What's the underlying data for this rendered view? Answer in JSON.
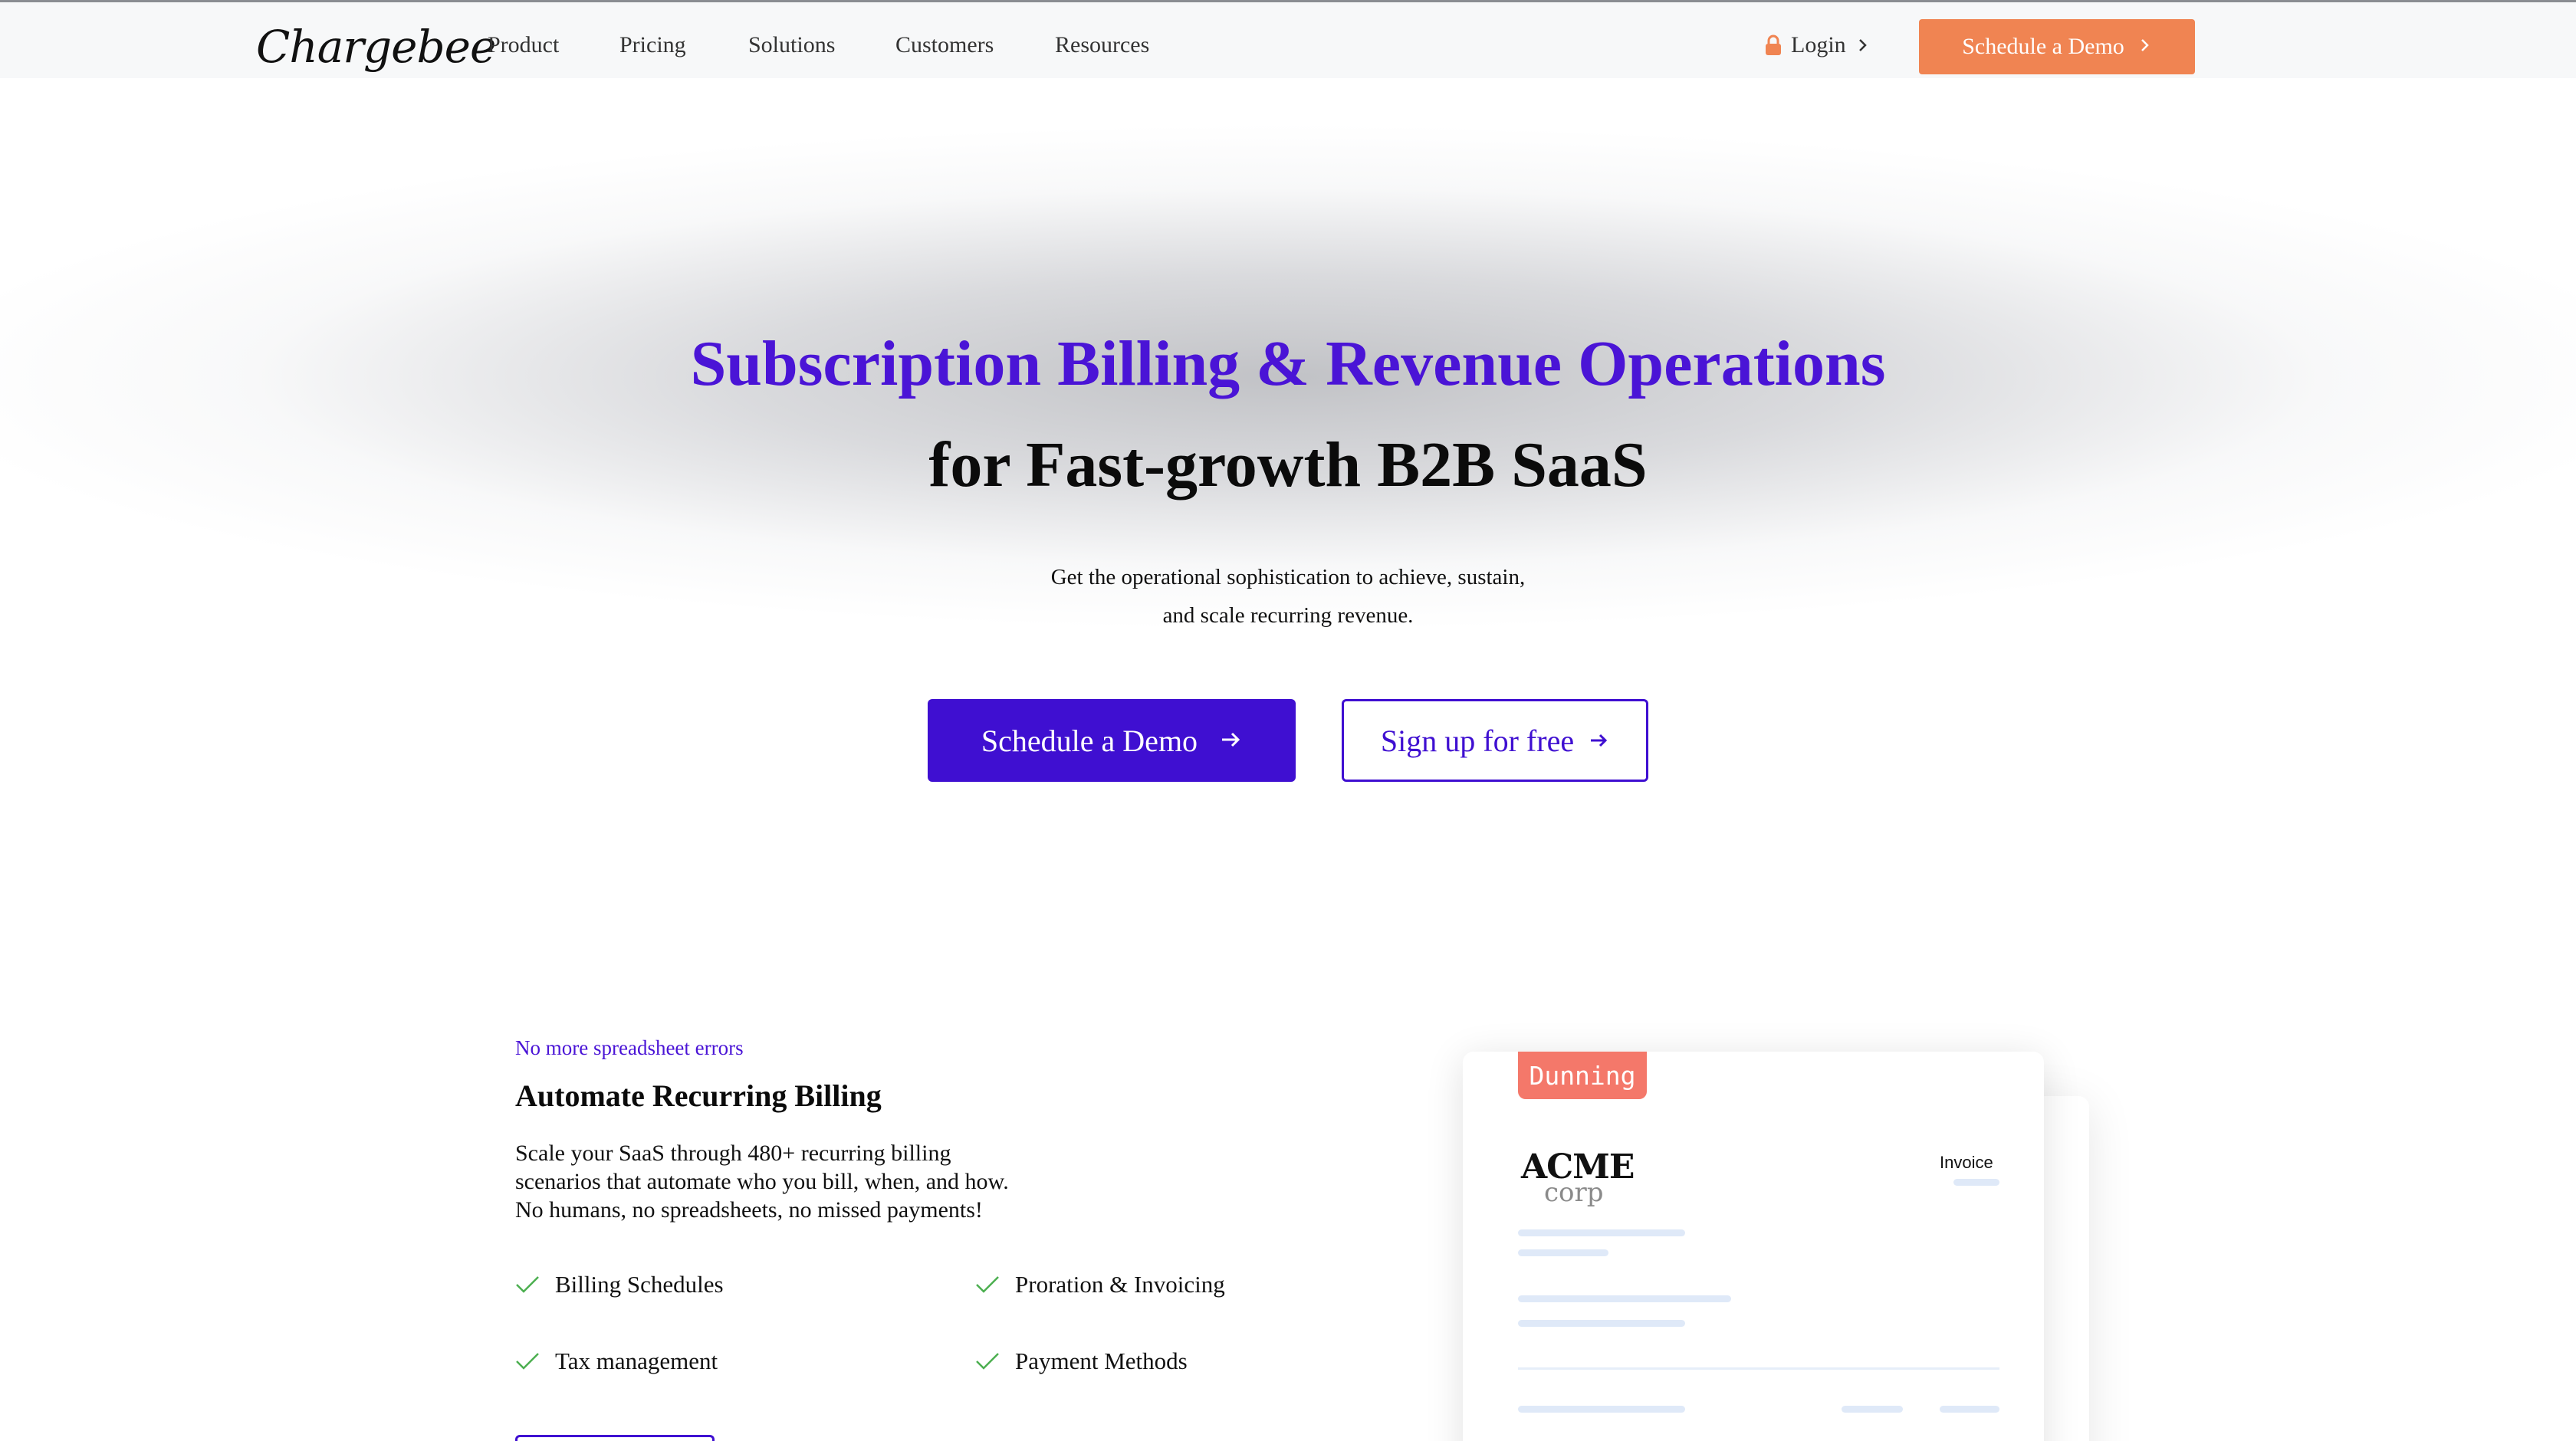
{
  "nav": {
    "logo": "Chargebee",
    "links": [
      "Product",
      "Pricing",
      "Solutions",
      "Customers",
      "Resources"
    ],
    "login": "Login",
    "cta": "Schedule a Demo"
  },
  "hero": {
    "title_line1": "Subscription Billing & Revenue Operations",
    "title_line2": "for Fast-growth B2B SaaS",
    "subtitle_line1": "Get the operational sophistication to achieve, sustain,",
    "subtitle_line2": "and scale recurring revenue.",
    "primary_button": "Schedule a Demo",
    "secondary_button": "Sign up for free"
  },
  "feature": {
    "eyebrow": "No more spreadsheet errors",
    "title": "Automate Recurring Billing",
    "description_lines": [
      "Scale your SaaS through 480+ recurring billing",
      "scenarios that automate who you bill, when, and how.",
      "No humans, no spreadsheets, no missed payments!"
    ],
    "checklist": [
      "Billing Schedules",
      "Proration & Invoicing",
      "Tax management",
      "Payment Methods"
    ]
  },
  "invoice_card": {
    "tag": "Dunning",
    "brand_top": "ACME",
    "brand_bottom": "corp",
    "label": "Invoice"
  },
  "colors": {
    "brand_purple": "#3f0fd1",
    "orange_cta": "#f08452",
    "dunning_tag": "#f4786a",
    "check_green": "#4caf50"
  }
}
